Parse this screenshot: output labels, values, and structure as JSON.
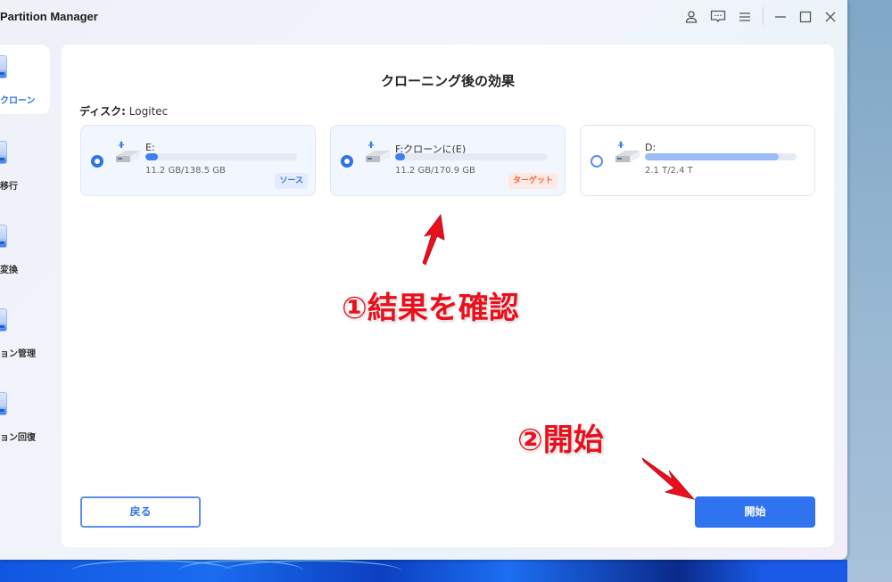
{
  "window": {
    "title": "Partition Manager",
    "controls": {
      "account": "user-icon",
      "feedback": "chat-icon",
      "menu": "menu-icon",
      "minimize": "minimize-icon",
      "maximize": "maximize-icon",
      "close": "close-icon"
    }
  },
  "sidebar": {
    "items": [
      {
        "label": "クローン",
        "icon": "disk-clone-icon",
        "active": true
      },
      {
        "label": "移行",
        "icon": "disk-migrate-icon",
        "active": false
      },
      {
        "label": "変換",
        "icon": "disk-convert-icon",
        "active": false
      },
      {
        "label": "ョン管理",
        "icon": "partition-manage-icon",
        "active": false
      },
      {
        "label": "ョン回復",
        "icon": "partition-recovery-icon",
        "active": false
      }
    ]
  },
  "main": {
    "title": "クローニング後の効果",
    "disk_label": "ディスク:",
    "disk_value": "Logitec",
    "disks": [
      {
        "name": "E:",
        "size": "11.2 GB/138.5 GB",
        "usage_fraction": 0.08,
        "selected": true,
        "badge": "ソース",
        "badge_type": "source"
      },
      {
        "name": "F:クローンに(E)",
        "size": "11.2 GB/170.9 GB",
        "usage_fraction": 0.065,
        "selected": true,
        "badge": "ターゲット",
        "badge_type": "target"
      },
      {
        "name": "D:",
        "size": "2.1 T/2.4 T",
        "usage_fraction": 0.88,
        "selected": false,
        "badge": null,
        "badge_type": null
      }
    ],
    "back_label": "戻る",
    "start_label": "開始"
  },
  "annotations": {
    "step1": "①結果を確認",
    "step2": "②開始",
    "color": "#e8101c"
  },
  "colors": {
    "accent": "#2f73f0",
    "source_badge": "#2f73e8",
    "target_badge": "#f2633a"
  }
}
